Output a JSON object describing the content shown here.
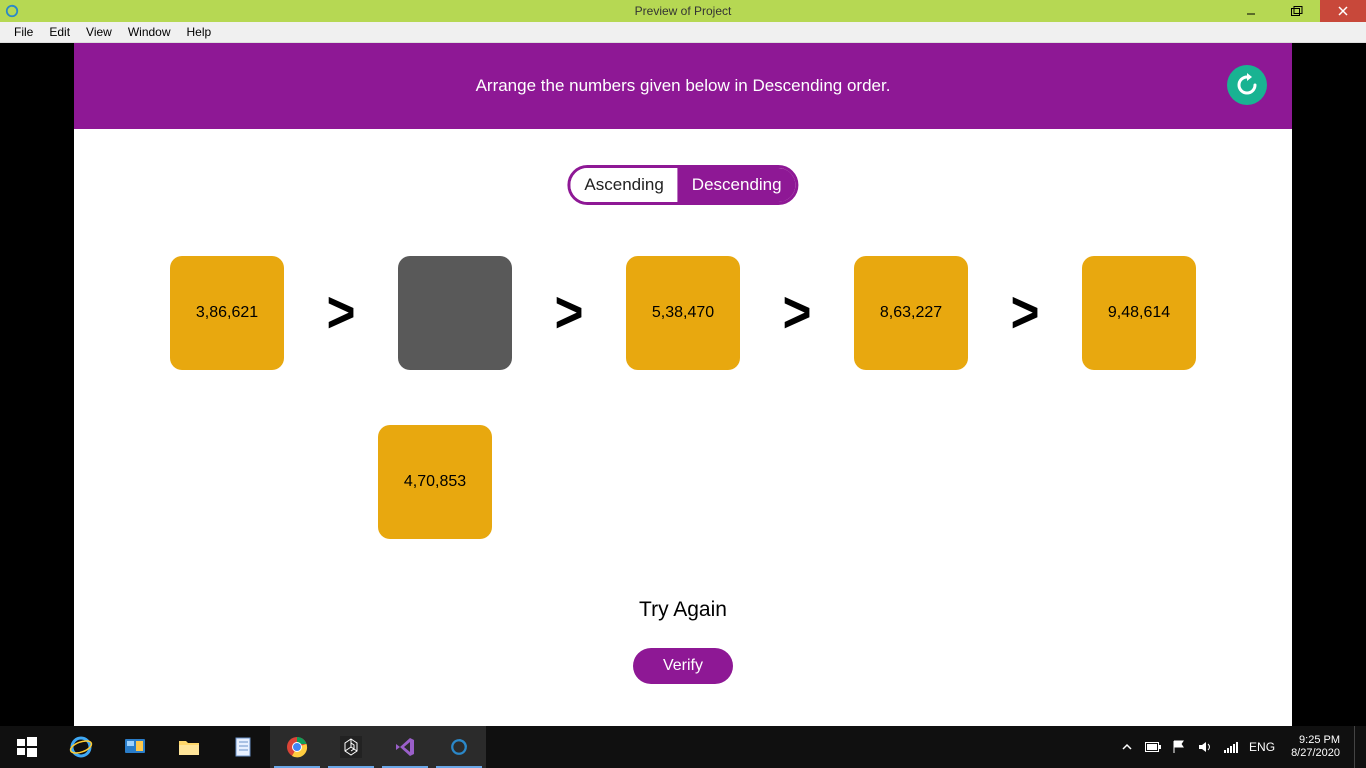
{
  "window": {
    "title": "Preview of Project"
  },
  "menu": {
    "items": [
      "File",
      "Edit",
      "View",
      "Window",
      "Help"
    ]
  },
  "header": {
    "instruction": "Arrange the numbers given below in Descending order."
  },
  "toggle": {
    "asc_label": "Ascending",
    "desc_label": "Descending"
  },
  "slots": [
    {
      "value": "3,86,621",
      "empty": false
    },
    {
      "value": "",
      "empty": true
    },
    {
      "value": "5,38,470",
      "empty": false
    },
    {
      "value": "8,63,227",
      "empty": false
    },
    {
      "value": "9,48,614",
      "empty": false
    }
  ],
  "separator": ">",
  "floating_card": {
    "value": "4,70,853"
  },
  "status_text": "Try Again",
  "verify_label": "Verify",
  "tray": {
    "lang": "ENG",
    "time": "9:25 PM",
    "date": "8/27/2020"
  }
}
